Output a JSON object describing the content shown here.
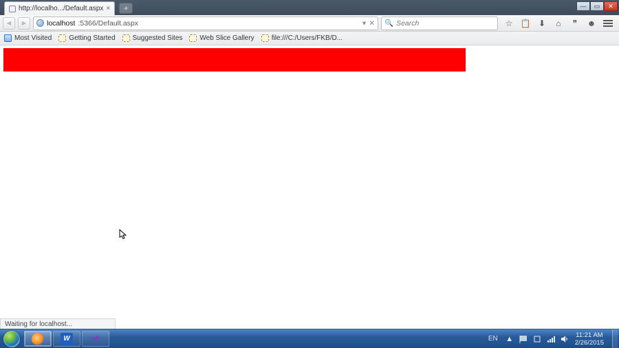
{
  "tab": {
    "title": "http://localho.../Default.aspx",
    "close_glyph": "×"
  },
  "newtab_glyph": "+",
  "window_controls": {
    "min": "—",
    "max": "▭",
    "close": "✕"
  },
  "nav": {
    "back": "◄",
    "fwd": "►",
    "url_host": "localhost",
    "url_port_path": ":5366/Default.aspx",
    "dropdown": "▾",
    "stop": "✕"
  },
  "search": {
    "icon": "🔍",
    "placeholder": "Search"
  },
  "toolbar_icons": {
    "bookmark_star": "☆",
    "clipboard": "📋",
    "downloads": "⬇",
    "home": "⌂",
    "pocket": "❞",
    "chat": "☻"
  },
  "bookmarks": [
    "Most Visited",
    "Getting Started",
    "Suggested Sites",
    "Web Slice Gallery",
    "file:///C:/Users/FKB/D..."
  ],
  "status_text": "Waiting for localhost...",
  "taskbar": {
    "word_label": "W",
    "lang": "EN",
    "tray_up": "▲",
    "time": "11:21 AM",
    "date": "2/26/2015"
  }
}
